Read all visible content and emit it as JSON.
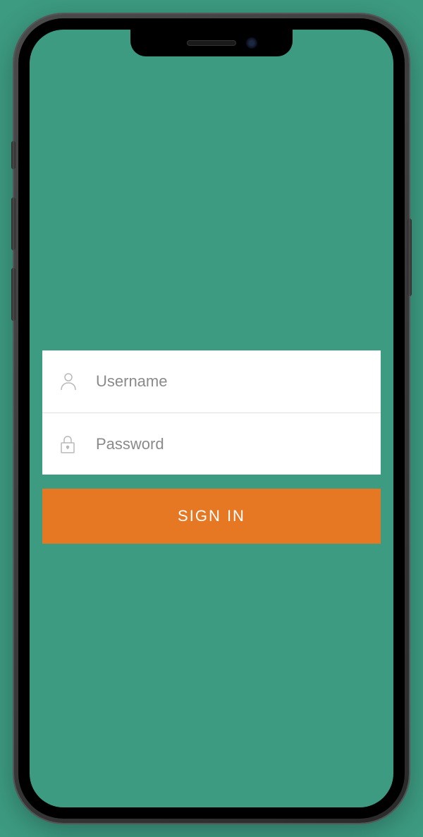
{
  "login": {
    "username_placeholder": "Username",
    "password_placeholder": "Password",
    "signin_label": "SIGN IN"
  },
  "colors": {
    "background": "#3d9b82",
    "button": "#e67824",
    "icon": "#b8b8b8"
  }
}
